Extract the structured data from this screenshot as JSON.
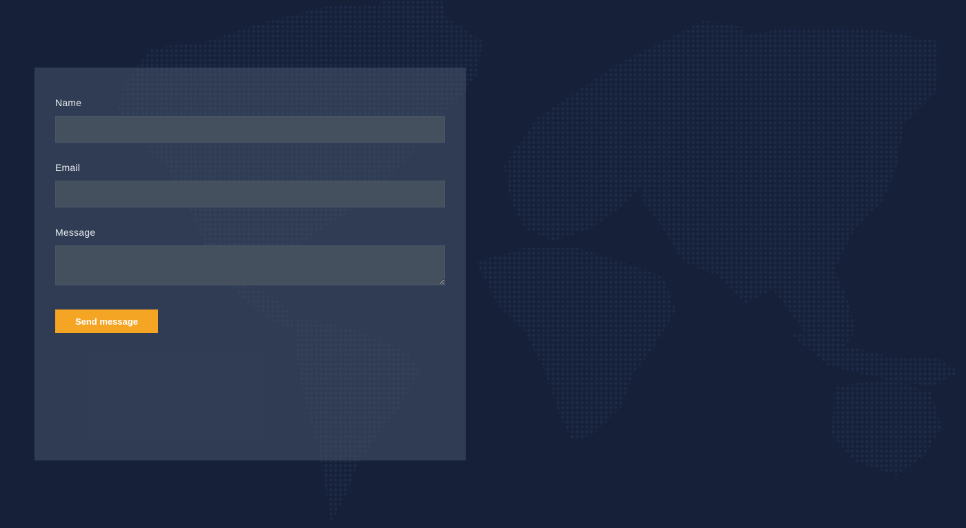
{
  "contact_form": {
    "name_label": "Name",
    "name_value": "",
    "email_label": "Email",
    "email_value": "",
    "message_label": "Message",
    "message_value": "",
    "send_label": "Send message"
  },
  "theme": {
    "background": "#162139",
    "panel": "#34405a",
    "input": "#45505f",
    "accent": "#f5a524",
    "label_text": "#e7ebf1",
    "map_dots": "#1c2947"
  },
  "background_graphic": {
    "type": "dotted-world-map",
    "icon": "world-map-dots"
  }
}
